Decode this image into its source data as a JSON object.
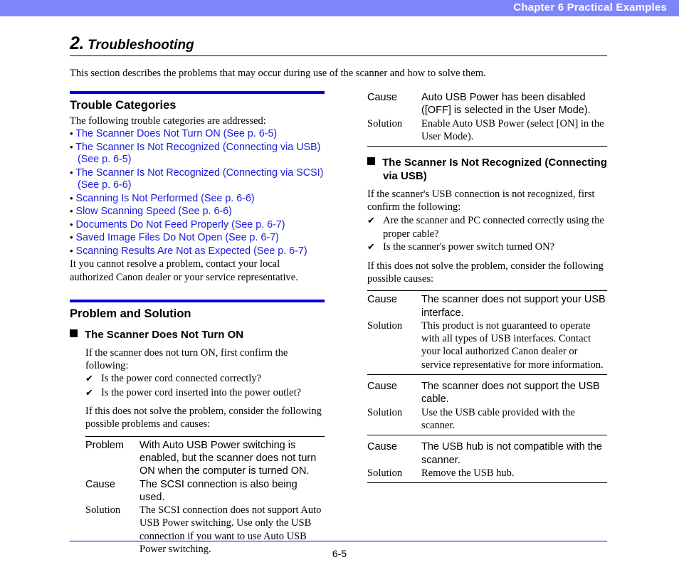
{
  "header": {
    "chapter": "Chapter 6",
    "title": "Practical Examples",
    "full": "Chapter 6   Practical Examples",
    "bar_color": "#7d85fa"
  },
  "section": {
    "number": "2.",
    "title": "Troubleshooting",
    "intro": "This section describes the problems that may occur during use of the scanner and how to solve them."
  },
  "colors": {
    "link_blue": "#1a1ae0",
    "rule_blue": "#0000d8",
    "header_periwinkle": "#7d85fa",
    "text_black": "#000000"
  },
  "trouble_categories": {
    "heading": "Trouble Categories",
    "intro": "The following trouble categories are addressed:",
    "items": [
      {
        "line1": "The Scanner Does Not Turn ON (See p. 6-5)",
        "line2": ""
      },
      {
        "line1": "The Scanner Is Not Recognized (Connecting via USB)",
        "line2": "(See p. 6-5)"
      },
      {
        "line1": "The Scanner Is Not Recognized (Connecting via",
        "line2": "SCSI) (See p. 6-6)"
      },
      {
        "line1": "Scanning Is Not Performed (See p. 6-6)",
        "line2": ""
      },
      {
        "line1": "Slow Scanning Speed (See p. 6-6)",
        "line2": ""
      },
      {
        "line1": "Documents Do Not Feed Properly (See p. 6-7)",
        "line2": ""
      },
      {
        "line1": "Saved Image Files Do Not Open (See p. 6-7)",
        "line2": ""
      },
      {
        "line1": "Scanning Results Are Not as Expected (See p. 6-7)",
        "line2": ""
      }
    ],
    "outro": "It you cannot resolve a problem, contact your local authorized Canon dealer or your service representative."
  },
  "problem_and_solution": {
    "heading": "Problem and Solution"
  },
  "scanner_does_not_turn_on": {
    "subheading": "The Scanner Does Not Turn ON",
    "intro": "If the scanner does not turn ON, first confirm the following:",
    "checks": [
      "Is the power cord connected correctly?",
      "Is the power cord inserted into the power outlet?"
    ],
    "followup": "If this does not solve the problem, consider the following possible problems and causes:",
    "rows": [
      {
        "label": "Problem",
        "style": "sans",
        "value": "With Auto USB Power switching is enabled, but the scanner does not turn ON when the computer is turned ON."
      },
      {
        "label": "Cause",
        "style": "sans",
        "value": "The SCSI connection is also being used."
      },
      {
        "label": "Solution",
        "style": "serif",
        "value": "The SCSI connection does not support Auto USB Power switching. Use only the USB connection if you want to use Auto USB Power switching."
      }
    ]
  },
  "right_column_continued_table": {
    "rows": [
      {
        "label": "Cause",
        "style": "sans",
        "value": "Auto USB Power has been disabled ([OFF] is selected in the User Mode)."
      },
      {
        "label": "Solution",
        "style": "serif",
        "value": "Enable Auto USB Power (select [ON] in the User Mode)."
      }
    ]
  },
  "scanner_not_recognized_usb": {
    "subheading_line1": "The Scanner Is Not Recognized (Connecting",
    "subheading_line2": "via USB)",
    "intro": "If the scanner's USB connection is not recognized, first confirm the following:",
    "checks": [
      "Are the scanner and PC connected correctly using the proper cable?",
      "Is the scanner's power switch turned ON?"
    ],
    "followup": "If this does not solve the problem, consider the following possible causes:",
    "groups": [
      {
        "rows": [
          {
            "label": "Cause",
            "style": "sans",
            "value": "The scanner does not support your USB interface."
          },
          {
            "label": "Solution",
            "style": "serif",
            "value": "This product is not guaranteed to operate with all types of USB interfaces. Contact your local authorized Canon dealer or service representative for more information."
          }
        ]
      },
      {
        "rows": [
          {
            "label": "Cause",
            "style": "sans",
            "value": "The scanner does not support the USB cable."
          },
          {
            "label": "Solution",
            "style": "serif",
            "value": "Use the USB cable provided with the scanner."
          }
        ]
      },
      {
        "rows": [
          {
            "label": "Cause",
            "style": "sans",
            "value": "The USB hub is not compatible with the scanner."
          },
          {
            "label": "Solution",
            "style": "serif",
            "value": "Remove the USB hub."
          }
        ]
      }
    ]
  },
  "footer": {
    "page_number": "6-5"
  },
  "glyphs": {
    "check": "✔",
    "bullet": "•"
  }
}
